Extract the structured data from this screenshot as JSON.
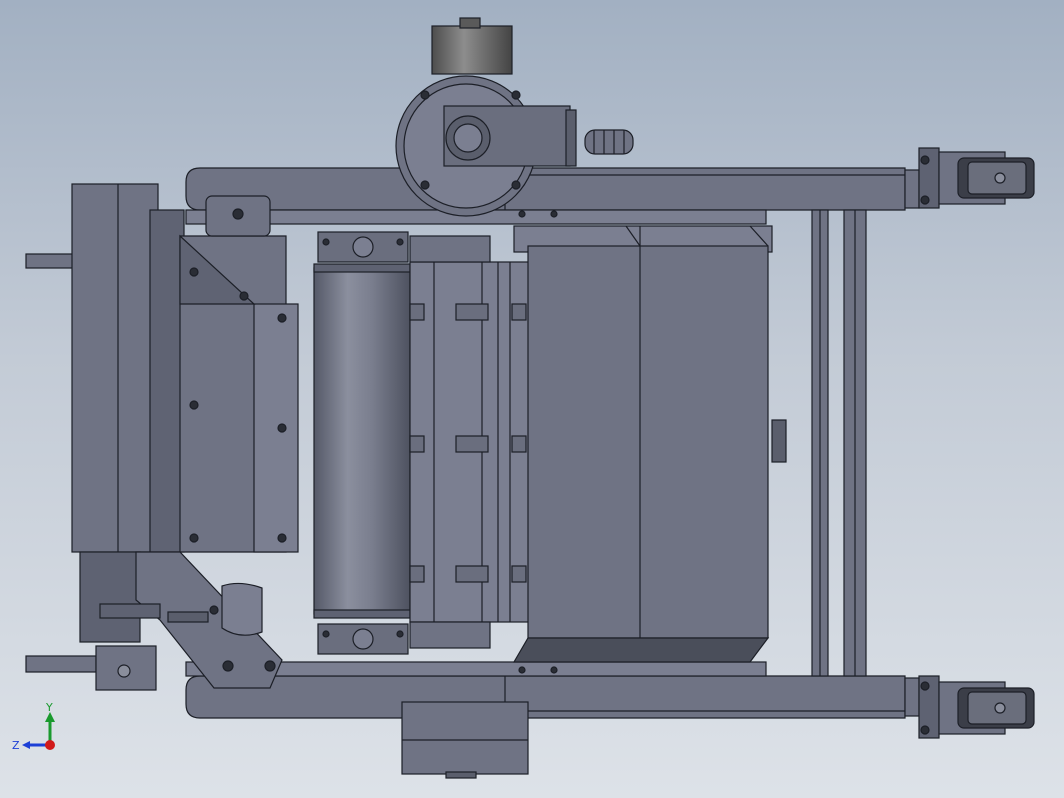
{
  "viewport": {
    "background_top": "#a2b0c2",
    "background_bottom": "#dde2e8"
  },
  "model": {
    "part_color": "#6f7384",
    "face_color": "#7b7f91",
    "dark_face_color": "#5a5e6c",
    "edge_color": "#1c1f27"
  },
  "triad": {
    "y_label": "Y",
    "z_label": "Z",
    "y_color": "#1a9a2e",
    "z_color": "#1c3fd6",
    "x_color": "#d11a1a"
  }
}
